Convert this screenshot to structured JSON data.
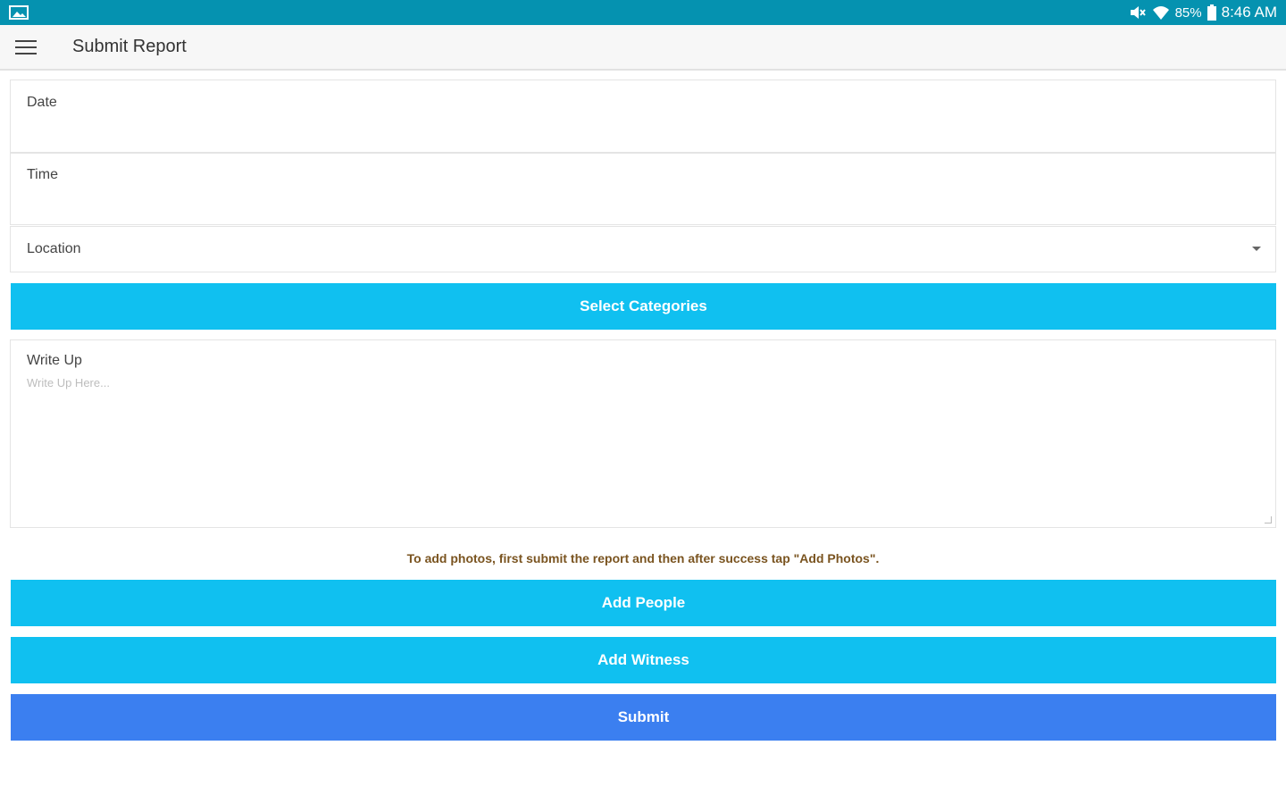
{
  "status_bar": {
    "battery_percent": "85%",
    "time": "8:46 AM",
    "icons": [
      "gallery-icon",
      "mute-icon",
      "wifi-icon",
      "battery-icon"
    ],
    "color": "#0592b0"
  },
  "app_bar": {
    "title": "Submit Report",
    "menu_icon": "hamburger-menu-icon"
  },
  "form": {
    "date_label": "Date",
    "time_label": "Time",
    "location_label": "Location",
    "location_icon": "dropdown-caret-icon",
    "select_categories_label": "Select Categories",
    "writeup_label": "Write Up",
    "writeup_placeholder": "Write Up Here...",
    "photos_note": "To add photos, first submit the report and then after success tap \"Add Photos\".",
    "add_people_label": "Add People",
    "add_witness_label": "Add Witness",
    "submit_label": "Submit"
  },
  "colors": {
    "primary_button": "#10c0f0",
    "submit_button": "#3b7ff0",
    "note_text": "#7a5420"
  }
}
